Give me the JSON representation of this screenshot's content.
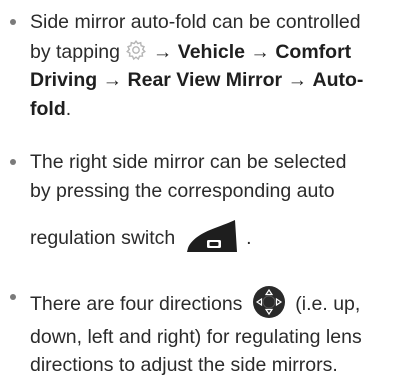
{
  "bullets": [
    {
      "lines": [
        {
          "pre": "Side mirror auto-fold can be controlled"
        },
        {
          "pre": "by tapping",
          "arrow1": "→",
          "b1": "Vehicle",
          "arrow2": "→",
          "b2": "Comfort"
        },
        {
          "b1": "Driving",
          "arrow1": "→",
          "b2": "Rear View Mirror",
          "arrow2": "→",
          "b3": "Auto-"
        },
        {
          "b1": "fold",
          "post": "."
        }
      ]
    },
    {
      "lines": [
        {
          "pre": "The right side mirror can be selected"
        },
        {
          "pre": "by pressing the corresponding auto"
        },
        {
          "pre": "regulation switch",
          "post": "."
        }
      ]
    },
    {
      "lines": [
        {
          "pre": "There are four directions",
          "post": "(i.e. up,"
        },
        {
          "pre": "down, left and right) for regulating lens"
        },
        {
          "pre": "directions to adjust the side mirrors."
        }
      ]
    }
  ],
  "icons": {
    "settings": "gear-icon",
    "switch": "auto-regulation-switch-icon",
    "directions": "four-direction-pad-icon"
  },
  "colors": {
    "text": "#2b2b2b",
    "bullet": "#7a7a7a",
    "switch": "#1e1e1e",
    "pad": "#2a2a2a",
    "gear": "#b5b5b5"
  }
}
